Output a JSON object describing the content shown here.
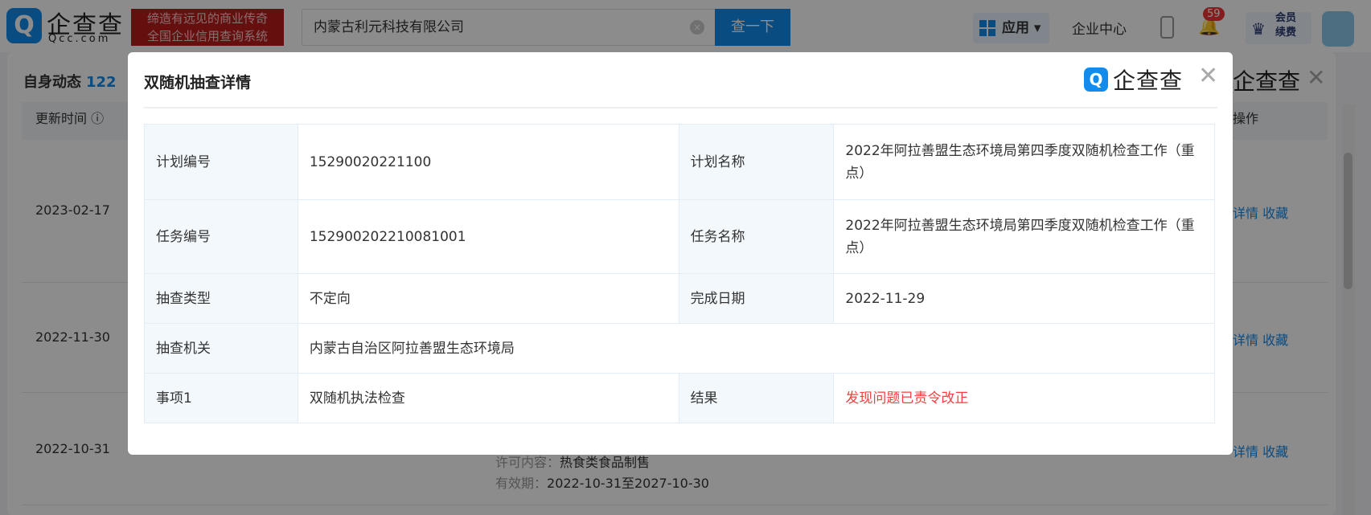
{
  "header": {
    "logo_text": "企查查",
    "logo_sub": "Qcc.com",
    "slogan": [
      "缔造有远见的商业传奇",
      "全国企业信用查询系统"
    ],
    "search_value": "内蒙古利元科技有限公司",
    "clear_icon": "×",
    "search_button": "查一下",
    "apps_label": "应用 ▾",
    "enterprise_center": "企业中心",
    "notification_count": "59",
    "vip_label": "会员续费"
  },
  "panel": {
    "title": "自身动态",
    "count": "122",
    "col_update_time": "更新时间 ⓘ",
    "col_action": "操作",
    "rows": [
      {
        "date": "2023-02-17",
        "detail": "详情",
        "fav": "收藏"
      },
      {
        "date": "2022-11-30",
        "detail": "详情",
        "fav": "收藏"
      },
      {
        "date": "2022-10-31",
        "detail": "详情",
        "fav": "收藏",
        "permit_label": "许可内容：",
        "permit": "热食类食品制售",
        "valid_label": "有效期：",
        "valid": "2022-10-31至2027-10-30"
      }
    ],
    "ghost_logo": "企查查"
  },
  "modal": {
    "title": "双随机抽查详情",
    "logo_text": "企查查",
    "close": "✕",
    "fields": {
      "plan_no_label": "计划编号",
      "plan_no": "15290020221100",
      "plan_name_label": "计划名称",
      "plan_name": "2022年阿拉善盟生态环境局第四季度双随机检查工作（重点）",
      "task_no_label": "任务编号",
      "task_no": "152900202210081001",
      "task_name_label": "任务名称",
      "task_name": "2022年阿拉善盟生态环境局第四季度双随机检查工作（重点）",
      "type_label": "抽查类型",
      "type": "不定向",
      "date_label": "完成日期",
      "date": "2022-11-29",
      "org_label": "抽查机关",
      "org": "内蒙古自治区阿拉善盟生态环境局",
      "item_label": "事项1",
      "item": "双随机执法检查",
      "result_label": "结果",
      "result": "发现问题已责令改正"
    }
  },
  "colors": {
    "accent": "#128bed",
    "result": "#f04142"
  }
}
